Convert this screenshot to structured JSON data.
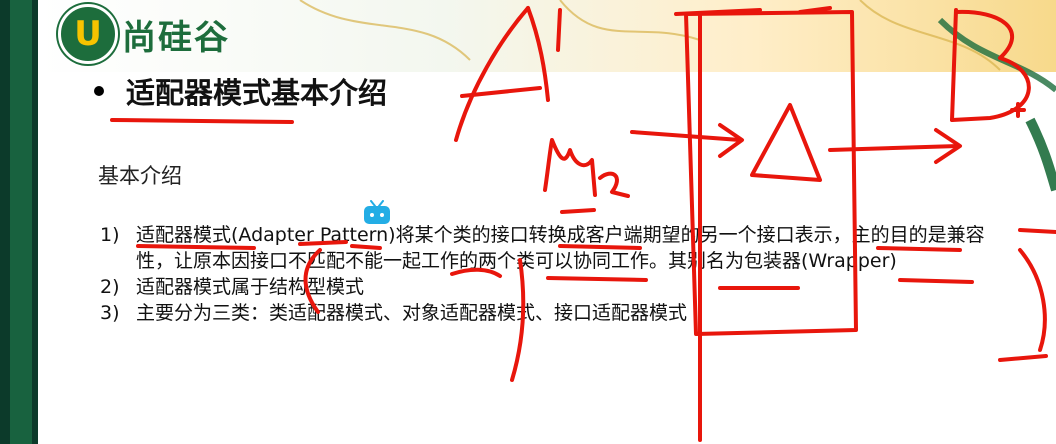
{
  "logo": {
    "badge_letter": "U",
    "brand": "尚硅谷"
  },
  "title": "适配器模式基本介绍",
  "section_label": "基本介绍",
  "items": [
    {
      "num": "1)",
      "text": "适配器模式(Adapter Pattern)将某个类的接口转换成客户端期望的另一个接口表示，主的目的是兼容性，让原本因接口不匹配不能一起工作的两个类可以协同工作。其别名为包装器(Wrapper)"
    },
    {
      "num": "2)",
      "text": "适配器模式属于结构型模式"
    },
    {
      "num": "3)",
      "text": "主要分为三类：类适配器模式、对象适配器模式、接口适配器模式"
    }
  ],
  "colors": {
    "ink": "#e8160c",
    "brand_green": "#1d6d3c",
    "brand_yellow": "#f7c300"
  },
  "icons": {
    "watermark": "bilibili-tv-icon"
  }
}
